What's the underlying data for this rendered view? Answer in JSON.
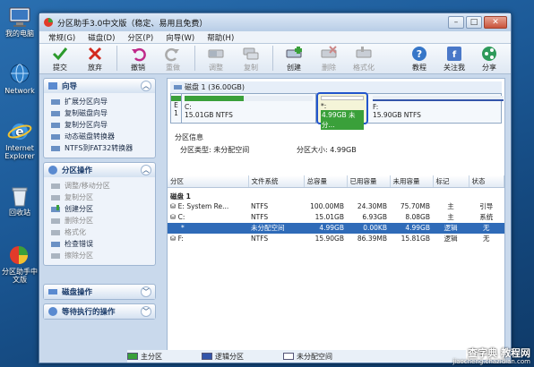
{
  "colors": {
    "primary": "#3aa03a",
    "logical": "#3355aa",
    "unallocated": "#ffffff",
    "selected_row": "#2f6bb8",
    "highlight_border": "#2255cc"
  },
  "desktop": {
    "icons": [
      {
        "label": "我的电脑",
        "icon": "computer-icon"
      },
      {
        "label": "Network",
        "icon": "network-icon"
      },
      {
        "label": "Internet Explorer",
        "icon": "ie-icon"
      },
      {
        "label": "回收站",
        "icon": "recycle-bin-icon"
      },
      {
        "label": "分区助手中文版",
        "icon": "partition-assistant-icon"
      }
    ]
  },
  "window": {
    "title": "分区助手3.0中文版（稳定、易用且免费）",
    "menu": [
      "常规(G)",
      "磁盘(D)",
      "分区(P)",
      "向导(W)",
      "帮助(H)"
    ]
  },
  "toolbar": {
    "left": [
      {
        "label": "提交",
        "icon": "commit-icon",
        "enabled": true
      },
      {
        "label": "放弃",
        "icon": "discard-icon",
        "enabled": true
      },
      {
        "label": "撤销",
        "icon": "undo-icon",
        "enabled": true
      },
      {
        "label": "重做",
        "icon": "redo-icon",
        "enabled": false
      },
      {
        "label": "调整",
        "icon": "resize-icon",
        "enabled": false
      },
      {
        "label": "复制",
        "icon": "copy-icon",
        "enabled": false
      },
      {
        "label": "创建",
        "icon": "create-icon",
        "enabled": true
      },
      {
        "label": "删除",
        "icon": "delete-icon",
        "enabled": false
      },
      {
        "label": "格式化",
        "icon": "format-icon",
        "enabled": false
      }
    ],
    "right": [
      {
        "label": "教程",
        "icon": "tutorial-icon"
      },
      {
        "label": "关注我",
        "icon": "follow-icon"
      },
      {
        "label": "分享",
        "icon": "share-icon"
      }
    ]
  },
  "sidebar": {
    "wizard": {
      "title": "向导",
      "items": [
        {
          "label": "扩展分区向导",
          "enabled": true
        },
        {
          "label": "复制磁盘向导",
          "enabled": true
        },
        {
          "label": "复制分区向导",
          "enabled": true
        },
        {
          "label": "动态磁盘转换器",
          "enabled": true
        },
        {
          "label": "NTFS到FAT32转换器",
          "enabled": true
        }
      ]
    },
    "partition_ops": {
      "title": "分区操作",
      "items": [
        {
          "label": "调整/移动分区",
          "enabled": false
        },
        {
          "label": "复制分区",
          "enabled": false
        },
        {
          "label": "创建分区",
          "enabled": true
        },
        {
          "label": "删除分区",
          "enabled": false
        },
        {
          "label": "格式化",
          "enabled": false
        },
        {
          "label": "检查错误",
          "enabled": true
        },
        {
          "label": "擦除分区",
          "enabled": false
        }
      ]
    },
    "disk_ops": {
      "title": "磁盘操作"
    },
    "pending_ops": {
      "title": "等待执行的操作"
    }
  },
  "disk_map": {
    "header": "磁盘 1 (36.00GB)",
    "segments": [
      {
        "name": "E",
        "sub": "1",
        "fill": 0.0
      },
      {
        "name": "C:",
        "sub": "15.01GB NTFS",
        "fill": 0.46
      },
      {
        "name": "*:",
        "sub": "4.99GB 未分...",
        "fill": 0.0
      },
      {
        "name": "F:",
        "sub": "15.90GB NTFS",
        "fill": 0.0
      }
    ]
  },
  "info": {
    "heading": "分区信息",
    "type_label": "分区类型: 未分配空间",
    "size_label": "分区大小: 4.99GB"
  },
  "table": {
    "columns": [
      "分区",
      "文件系统",
      "总容量",
      "已用容量",
      "未用容量",
      "标记",
      "状态"
    ],
    "group": "磁盘 1",
    "rows": [
      {
        "name": "E:  System Re...",
        "fs": "NTFS",
        "total": "100.00MB",
        "used": "24.30MB",
        "free": "75.70MB",
        "flag": "主",
        "status": "引导",
        "selected": false,
        "icon": "drive-icon"
      },
      {
        "name": "C:",
        "fs": "NTFS",
        "total": "15.01GB",
        "used": "6.93GB",
        "free": "8.08GB",
        "flag": "主",
        "status": "系统",
        "selected": false,
        "icon": "drive-icon"
      },
      {
        "name": "*",
        "fs": "未分配空间",
        "total": "4.99GB",
        "used": "0.00KB",
        "free": "4.99GB",
        "flag": "逻辑",
        "status": "无",
        "selected": true,
        "icon": "drive-icon"
      },
      {
        "name": "F:",
        "fs": "NTFS",
        "total": "15.90GB",
        "used": "86.39MB",
        "free": "15.81GB",
        "flag": "逻辑",
        "status": "无",
        "selected": false,
        "icon": "drive-icon"
      }
    ]
  },
  "legend": [
    {
      "label": "主分区",
      "color": "#3aa03a"
    },
    {
      "label": "逻辑分区",
      "color": "#3355aa"
    },
    {
      "label": "未分配空间",
      "color": "#ffffff"
    }
  ],
  "watermark": {
    "title": "查字典 教程网",
    "sub": "jiaocheng.chazidian.com"
  }
}
